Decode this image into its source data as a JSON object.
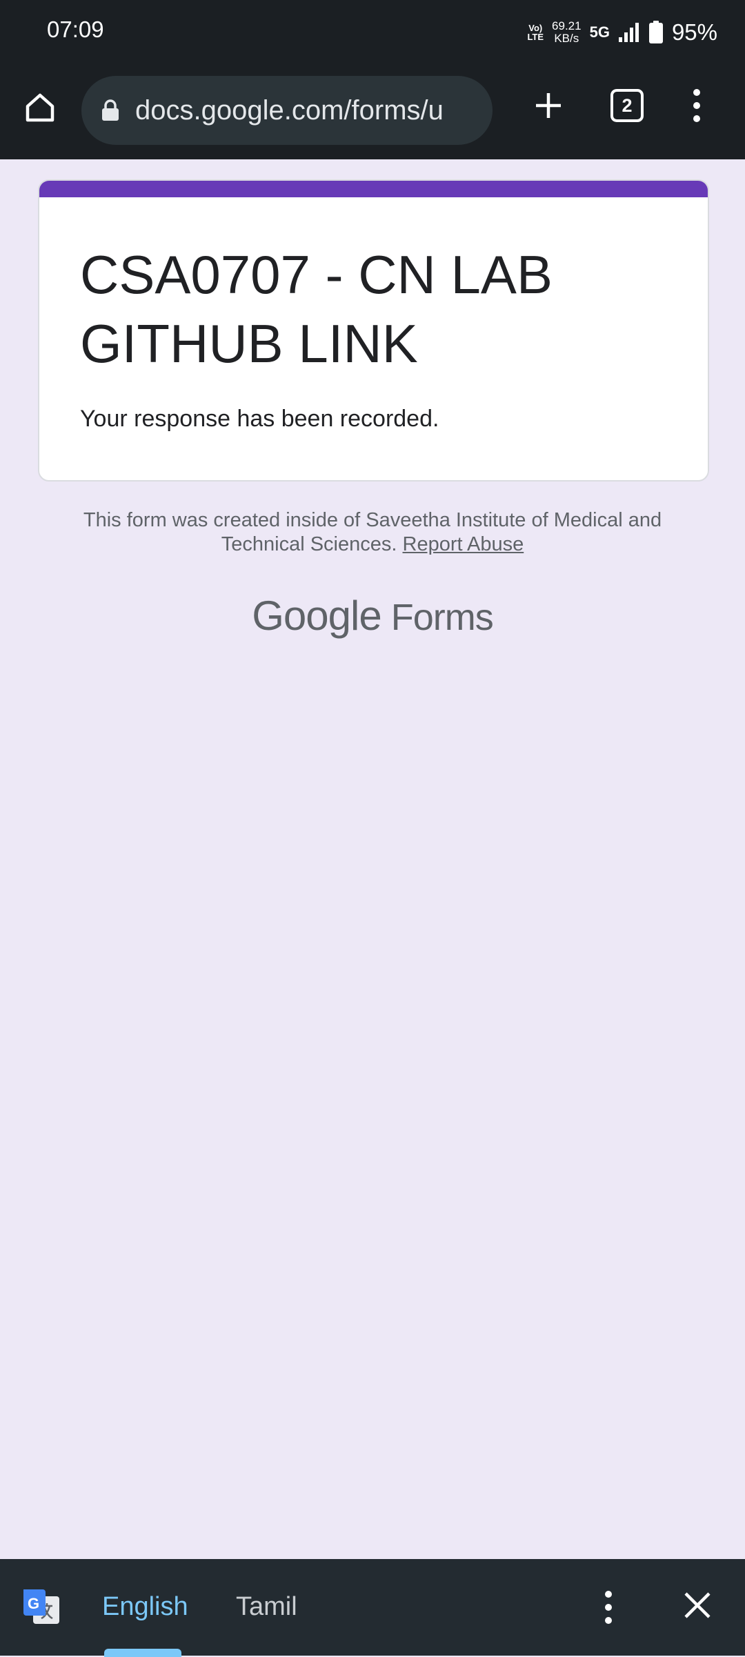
{
  "status_bar": {
    "time": "07:09",
    "volte_top": "Vo)",
    "volte_bottom": "LTE",
    "speed_value": "69.21",
    "speed_unit": "KB/s",
    "network": "5G",
    "battery": "95%"
  },
  "browser": {
    "url": "docs.google.com/forms/u",
    "tab_count": "2",
    "icons": [
      "home-icon",
      "lock-icon",
      "plus-icon",
      "tabs-icon",
      "more-vert-icon"
    ]
  },
  "form": {
    "accent_color": "#673ab7",
    "title": "CSA0707 - CN LAB GITHUB LINK",
    "message": "Your response has been recorded."
  },
  "footer": {
    "note": "This form was created inside of Saveetha Institute of Medical and Technical Sciences.",
    "report_link": "Report Abuse",
    "logo_google": "Google",
    "logo_forms": "Forms"
  },
  "translate_bar": {
    "languages": [
      "English",
      "Tamil"
    ],
    "selected": "English",
    "active_color": "#7cc8f8"
  }
}
